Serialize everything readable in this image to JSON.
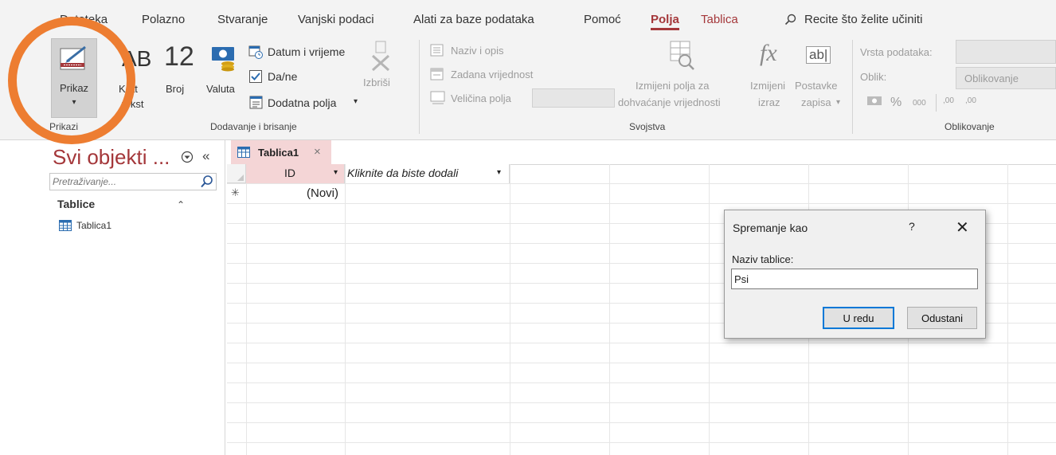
{
  "ribbon": {
    "tabs": [
      "Datoteka",
      "Polazno",
      "Stvaranje",
      "Vanjski podaci",
      "Alati za baze podataka",
      "Pomoć",
      "Polja",
      "Tablica"
    ],
    "active_tab": "Polja",
    "tell_me": "Recite što želite učiniti",
    "groups": {
      "prikazi": {
        "label": "Prikazi",
        "prikaz": "Prikaz"
      },
      "dodavanje": {
        "label": "Dodavanje i brisanje",
        "kratki_tekst_1": "Krat",
        "kratki_tekst_2": "tekst",
        "broj": "Broj",
        "valuta": "Valuta",
        "datum": "Datum i vrijeme",
        "dane": "Da/ne",
        "dodatna": "Dodatna polja",
        "izbrisi": "Izbriši",
        "broj_glyph": "12",
        "ab_glyph": "AB"
      },
      "svojstva": {
        "label": "Svojstva",
        "naziv_opis": "Naziv i opis",
        "zadana": "Zadana vrijednost",
        "velicina": "Veličina polja",
        "izmijeni_pretr_1": "Izmijeni polja za",
        "izmijeni_pretr_2": "dohvaćanje vrijednosti",
        "izmijeni_izraz_1": "Izmijeni",
        "izmijeni_izraz_2": "izraz",
        "postavke_1": "Postavke",
        "postavke_2": "zapisa",
        "fx_glyph": "fx",
        "abl_glyph": "ab|"
      },
      "oblikovanje": {
        "label": "Oblikovanje",
        "vrsta": "Vrsta podataka:",
        "oblik": "Oblik:",
        "oblikovanje_value": "Oblikovanje",
        "percent": "%",
        "thousands": "000",
        "inc_dec": ",00",
        "dec_dec": ",00"
      }
    }
  },
  "nav": {
    "title": "Svi objekti ...",
    "search_placeholder": "Pretraživanje...",
    "group": "Tablice",
    "items": [
      "Tablica1"
    ]
  },
  "datasheet": {
    "tab_label": "Tablica1",
    "col_id": "ID",
    "col_add": "Kliknite da biste dodali",
    "new_row": "(Novi)",
    "new_marker": "✳"
  },
  "dialog": {
    "title": "Spremanje kao",
    "help": "?",
    "label": "Naziv tablice:",
    "value": "Psi",
    "ok": "U redu",
    "cancel": "Odustani"
  },
  "colors": {
    "accent": "#a4373a",
    "highlight_circle": "#ed7d31",
    "ribbon_bg": "#f3f3f3",
    "tab_pink": "#f4d5d6"
  }
}
